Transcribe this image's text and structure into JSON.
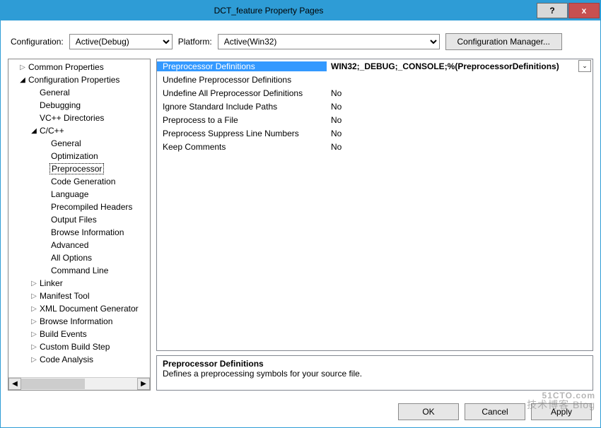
{
  "titlebar": {
    "title": "DCT_feature Property Pages",
    "help": "?",
    "close": "x"
  },
  "config": {
    "label_config": "Configuration:",
    "value_config": "Active(Debug)",
    "label_platform": "Platform:",
    "value_platform": "Active(Win32)",
    "btn_manager": "Configuration Manager..."
  },
  "tree": [
    {
      "text": "Common Properties",
      "arrow": "▷",
      "indent": 1
    },
    {
      "text": "Configuration Properties",
      "arrow": "◢",
      "indent": 1
    },
    {
      "text": "General",
      "arrow": "",
      "indent": 2
    },
    {
      "text": "Debugging",
      "arrow": "",
      "indent": 2
    },
    {
      "text": "VC++ Directories",
      "arrow": "",
      "indent": 2
    },
    {
      "text": "C/C++",
      "arrow": "◢",
      "indent": 2
    },
    {
      "text": "General",
      "arrow": "",
      "indent": 3
    },
    {
      "text": "Optimization",
      "arrow": "",
      "indent": 3
    },
    {
      "text": "Preprocessor",
      "arrow": "",
      "indent": 3,
      "selected": true
    },
    {
      "text": "Code Generation",
      "arrow": "",
      "indent": 3
    },
    {
      "text": "Language",
      "arrow": "",
      "indent": 3
    },
    {
      "text": "Precompiled Headers",
      "arrow": "",
      "indent": 3
    },
    {
      "text": "Output Files",
      "arrow": "",
      "indent": 3
    },
    {
      "text": "Browse Information",
      "arrow": "",
      "indent": 3
    },
    {
      "text": "Advanced",
      "arrow": "",
      "indent": 3
    },
    {
      "text": "All Options",
      "arrow": "",
      "indent": 3
    },
    {
      "text": "Command Line",
      "arrow": "",
      "indent": 3
    },
    {
      "text": "Linker",
      "arrow": "▷",
      "indent": 2
    },
    {
      "text": "Manifest Tool",
      "arrow": "▷",
      "indent": 2
    },
    {
      "text": "XML Document Generator",
      "arrow": "▷",
      "indent": 2
    },
    {
      "text": "Browse Information",
      "arrow": "▷",
      "indent": 2
    },
    {
      "text": "Build Events",
      "arrow": "▷",
      "indent": 2
    },
    {
      "text": "Custom Build Step",
      "arrow": "▷",
      "indent": 2
    },
    {
      "text": "Code Analysis",
      "arrow": "▷",
      "indent": 2
    }
  ],
  "props": [
    {
      "name": "Preprocessor Definitions",
      "value": "WIN32;_DEBUG;_CONSOLE;%(PreprocessorDefinitions)",
      "selected": true,
      "dd": true
    },
    {
      "name": "Undefine Preprocessor Definitions",
      "value": ""
    },
    {
      "name": "Undefine All Preprocessor Definitions",
      "value": "No"
    },
    {
      "name": "Ignore Standard Include Paths",
      "value": "No"
    },
    {
      "name": "Preprocess to a File",
      "value": "No"
    },
    {
      "name": "Preprocess Suppress Line Numbers",
      "value": "No"
    },
    {
      "name": "Keep Comments",
      "value": "No"
    }
  ],
  "desc": {
    "title": "Preprocessor Definitions",
    "body": "Defines a preprocessing symbols for your source file."
  },
  "footer": {
    "ok": "OK",
    "cancel": "Cancel",
    "apply": "Apply"
  },
  "watermark": {
    "line1": "51CTO.com",
    "line2": "技术博客 Blog"
  },
  "hscroll": {
    "left": "◀",
    "right": "▶"
  }
}
